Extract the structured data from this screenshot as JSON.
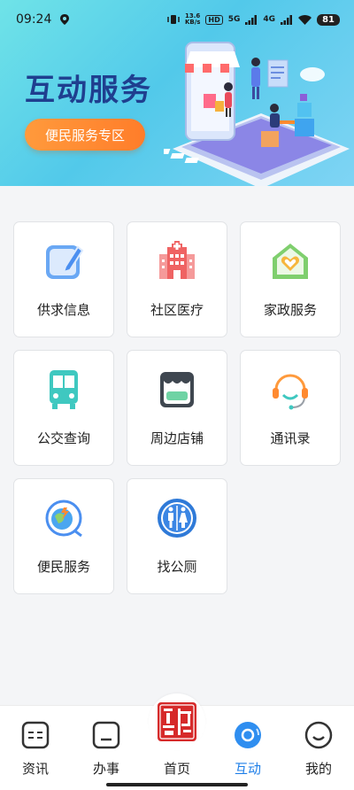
{
  "status_bar": {
    "time": "09:24",
    "net_speed_top": "13.6",
    "net_speed_bottom": "KB/s",
    "hd": "HD",
    "sig1": "5G",
    "sig2": "4G",
    "battery": "81"
  },
  "banner": {
    "title": "互动服务",
    "button_label": "便民服务专区"
  },
  "services": [
    {
      "label": "供求信息",
      "icon": "edit-note-icon"
    },
    {
      "label": "社区医疗",
      "icon": "hospital-icon"
    },
    {
      "label": "家政服务",
      "icon": "house-heart-icon"
    },
    {
      "label": "公交查询",
      "icon": "bus-icon"
    },
    {
      "label": "周边店铺",
      "icon": "store-icon"
    },
    {
      "label": "通讯录",
      "icon": "headset-icon"
    },
    {
      "label": "便民服务",
      "icon": "globe-service-icon"
    },
    {
      "label": "找公厕",
      "icon": "restroom-icon"
    }
  ],
  "bottom_nav": {
    "items": [
      {
        "label": "资讯",
        "icon": "news-icon"
      },
      {
        "label": "办事",
        "icon": "task-icon"
      },
      {
        "label": "首页",
        "icon": "home-seal-icon"
      },
      {
        "label": "互动",
        "icon": "interact-icon",
        "active": true
      },
      {
        "label": "我的",
        "icon": "profile-smile-icon"
      }
    ]
  },
  "colors": {
    "active": "#1f7fe8",
    "accent_orange": "#ff8a30",
    "banner_title": "#1f3f8f"
  }
}
